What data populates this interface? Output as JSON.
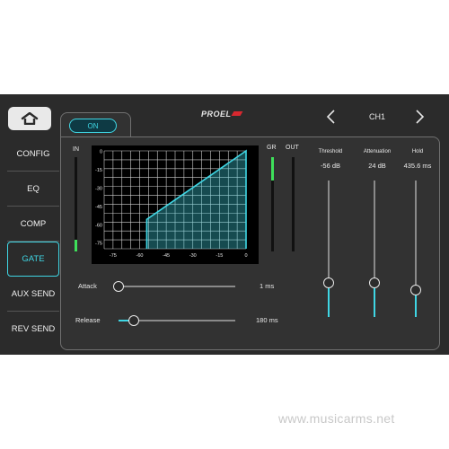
{
  "header": {
    "home_icon": "home-icon",
    "brand": "PROEL",
    "channel": "CH1",
    "prev_icon": "chevron-left-icon",
    "next_icon": "chevron-right-icon"
  },
  "menu": {
    "items": [
      {
        "label": "CONFIG",
        "active": false
      },
      {
        "label": "EQ",
        "active": false
      },
      {
        "label": "COMP",
        "active": false
      },
      {
        "label": "GATE",
        "active": true
      },
      {
        "label": "AUX SEND",
        "active": false
      },
      {
        "label": "REV SEND",
        "active": false
      }
    ]
  },
  "gate": {
    "on_label": "ON",
    "in_label": "IN",
    "gr_label": "GR",
    "out_label": "OUT",
    "in_level": 0.12,
    "gr_level": 0.25,
    "out_level": 0.0,
    "graph": {
      "y_ticks": [
        "0",
        "-15",
        "-30",
        "-45",
        "-60",
        "-75"
      ],
      "x_ticks": [
        "-75",
        "-60",
        "-45",
        "-30",
        "-15",
        "0"
      ],
      "threshold_db": -56,
      "accent": "#3fd6e4"
    },
    "attack": {
      "label": "Attack",
      "value": "1 ms",
      "position": 0.0
    },
    "release": {
      "label": "Release",
      "value": "180 ms",
      "position": 0.13
    },
    "threshold": {
      "label": "Threshold",
      "value": "-56 dB",
      "position": 0.25
    },
    "attenuation": {
      "label": "Attenuation",
      "value": "24 dB",
      "position": 0.25
    },
    "hold": {
      "label": "Hold",
      "value": "435.6 ms",
      "position": 0.2
    }
  },
  "watermark": "www.musicarms.net",
  "colors": {
    "accent": "#3fd6e4",
    "meter_green": "#3ee05a",
    "brand_red": "#d8282f"
  }
}
